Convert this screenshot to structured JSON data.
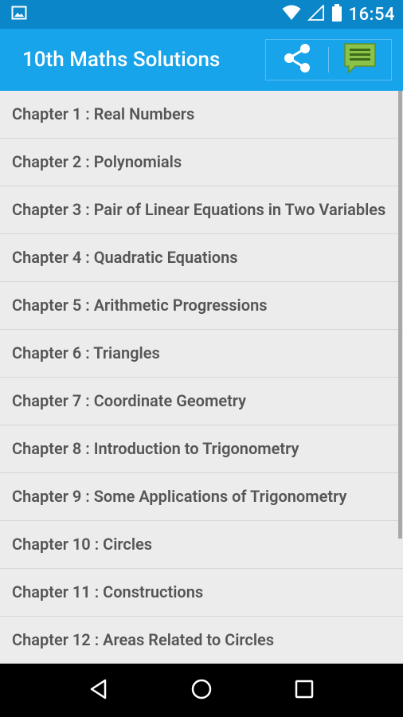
{
  "status_bar": {
    "time": "16:54",
    "icons": [
      "image-icon",
      "wifi-icon",
      "signal-icon",
      "battery-icon"
    ]
  },
  "app_bar": {
    "title": "10th Maths Solutions",
    "actions": [
      {
        "name": "share-icon",
        "label": "Share"
      },
      {
        "name": "message-icon",
        "label": "Feedback"
      }
    ]
  },
  "chapters": [
    "Chapter 1 : Real Numbers",
    "Chapter 2 : Polynomials",
    "Chapter 3 : Pair of Linear Equations in Two Variables",
    "Chapter 4 : Quadratic Equations",
    "Chapter 5 : Arithmetic Progressions",
    "Chapter 6 : Triangles",
    "Chapter 7 : Coordinate Geometry",
    "Chapter 8 : Introduction to Trigonometry",
    "Chapter 9 : Some Applications of Trigonometry",
    "Chapter 10 : Circles",
    "Chapter 11 : Constructions",
    "Chapter 12 : Areas Related to Circles"
  ],
  "colors": {
    "status_bar": "#0a86c9",
    "app_bar": "#18a4ea",
    "list_background": "#ececec",
    "text": "#555555",
    "message_icon": "#8bc34a"
  },
  "nav_bar": {
    "buttons": [
      "back-icon",
      "home-icon",
      "recents-icon"
    ]
  }
}
